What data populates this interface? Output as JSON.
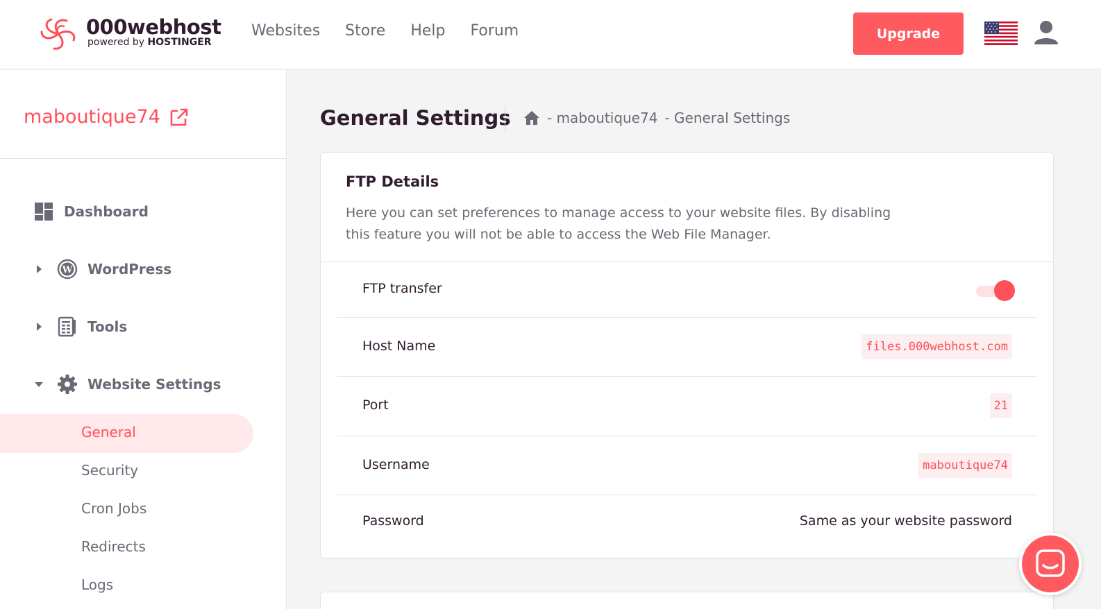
{
  "header": {
    "logo_title": "000webhost",
    "logo_powered": "powered by",
    "logo_brand": "HOSTINGER",
    "nav": [
      "Websites",
      "Store",
      "Help",
      "Forum"
    ],
    "upgrade_label": "Upgrade"
  },
  "sidebar": {
    "site_name": "maboutique74",
    "items": [
      {
        "label": "Dashboard",
        "icon": "dashboard-icon"
      },
      {
        "label": "WordPress",
        "icon": "wordpress-icon"
      },
      {
        "label": "Tools",
        "icon": "tools-icon"
      },
      {
        "label": "Website Settings",
        "icon": "gear-icon"
      }
    ],
    "sub_items": [
      "General",
      "Security",
      "Cron Jobs",
      "Redirects",
      "Logs"
    ]
  },
  "main": {
    "title": "General Settings",
    "breadcrumb": {
      "site": "- maboutique74",
      "page": "- General Settings"
    },
    "ftp": {
      "title": "FTP Details",
      "description": "Here you can set preferences to manage access to your website files. By disabling this feature you will not be able to access the Web File Manager.",
      "rows": [
        {
          "label": "FTP transfer",
          "toggle_on": true
        },
        {
          "label": "Host Name",
          "value": "files.000webhost.com"
        },
        {
          "label": "Port",
          "value": "21"
        },
        {
          "label": "Username",
          "value": "maboutique74"
        },
        {
          "label": "Password",
          "value": "Same as your website password"
        }
      ]
    }
  },
  "colors": {
    "accent": "#ff5a5f",
    "text": "#2f1c2e",
    "muted": "#6d6875"
  }
}
